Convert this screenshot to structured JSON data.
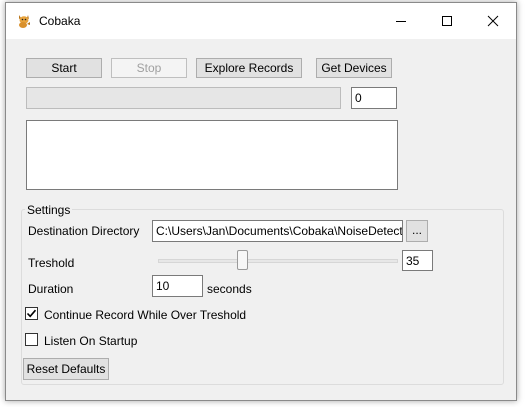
{
  "window": {
    "title": "Cobaka",
    "icon": "cobaka-app-icon"
  },
  "toolbar": {
    "start_label": "Start",
    "stop_label": "Stop",
    "explore_label": "Explore Records",
    "devices_label": "Get Devices"
  },
  "progress": {
    "value": 0,
    "counter": "0"
  },
  "log": {
    "text": ""
  },
  "settings": {
    "group_title": "Settings",
    "destination_label": "Destination Directory",
    "destination_value": "C:\\Users\\Jan\\Documents\\Cobaka\\NoiseDetected",
    "browse_label": "...",
    "threshold_label": "Treshold",
    "threshold_value": "35",
    "threshold_slider_fraction": 0.35,
    "duration_label": "Duration",
    "duration_value": "10",
    "duration_unit": "seconds",
    "continue_record_label": "Continue Record While Over Treshold",
    "continue_record_checked": true,
    "listen_startup_label": "Listen On Startup",
    "listen_startup_checked": false,
    "reset_label": "Reset Defaults"
  }
}
